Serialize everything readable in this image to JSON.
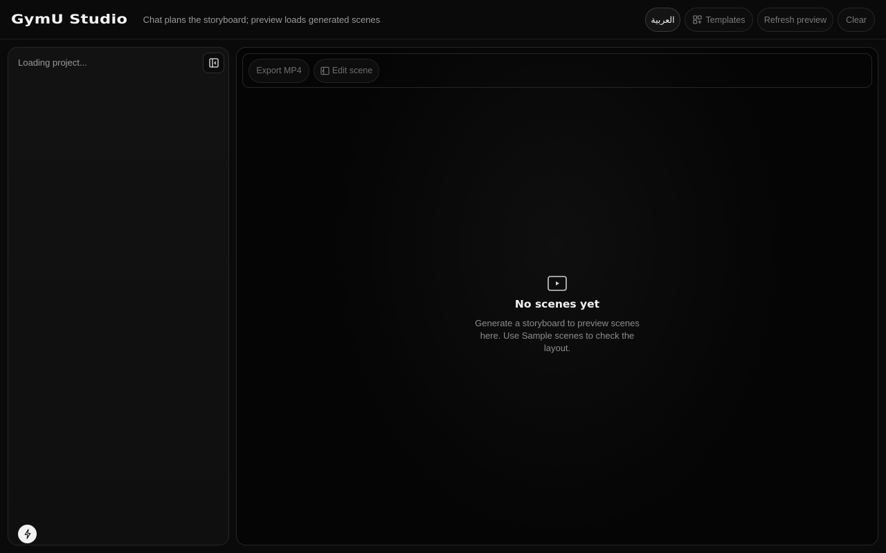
{
  "header": {
    "brand": "GymU Studio",
    "tagline": "Chat plans the storyboard; preview loads generated scenes",
    "language_label": "العربية",
    "templates_label": "Templates",
    "refresh_label": "Refresh preview",
    "clear_label": "Clear"
  },
  "sidebar": {
    "loading_text": "Loading project...",
    "collapse_icon": "panel-collapse-icon",
    "bolt_icon": "bolt-icon"
  },
  "toolbar": {
    "export_label": "Export MP4",
    "edit_label": "Edit scene"
  },
  "empty_state": {
    "icon": "play-icon",
    "title": "No scenes yet",
    "description": "Generate a storyboard to preview scenes here. Use Sample scenes to check the layout."
  },
  "colors": {
    "background": "#0a0a0a",
    "border": "#262626",
    "text_primary": "#f2f2f2",
    "text_muted": "#8c8c8c"
  }
}
